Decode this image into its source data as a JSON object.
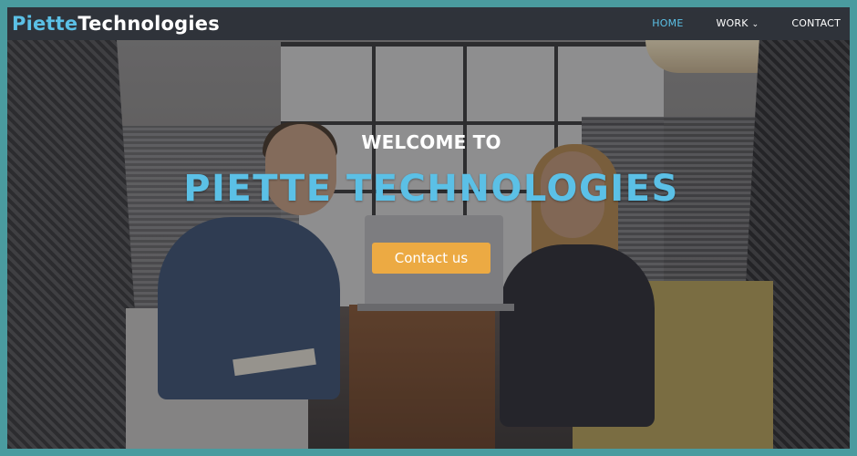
{
  "brand": {
    "part1": "Piette",
    "part2": "Technologies"
  },
  "nav": {
    "items": [
      {
        "label": "HOME",
        "active": true
      },
      {
        "label": "WORK",
        "has_dropdown": true
      },
      {
        "label": "CONTACT"
      }
    ]
  },
  "hero": {
    "pretitle": "WELCOME TO",
    "title": "PIETTE TECHNOLOGIES",
    "cta_label": "Contact us"
  },
  "colors": {
    "accent": "#5bc0e6",
    "cta": "#ecaa43",
    "navbar": "#282c34",
    "frame": "#4a9b9f"
  }
}
